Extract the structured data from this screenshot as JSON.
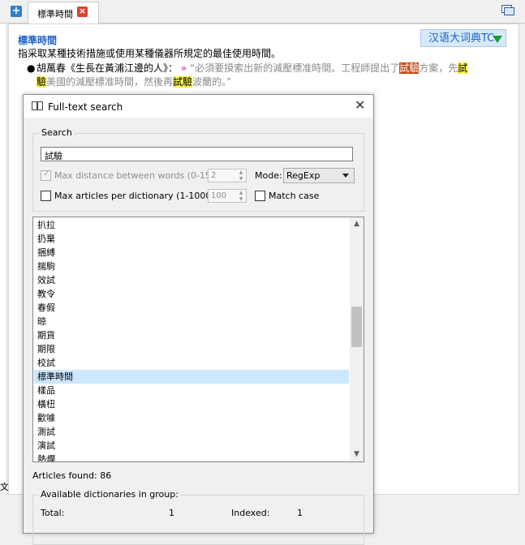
{
  "main": {
    "tab_label": "標準時間",
    "dict_button": "汉语大词典TC",
    "left_snippet": "文当代",
    "headword": "標準時間",
    "definition": "指采取某種技術措施或使用某種儀器所規定的最佳使用時間。",
    "example": {
      "author": "胡萬春《生長在黃浦江邊的人》：",
      "arrow": "»",
      "q1": "“必須要摸索出新的減壓標准時間。工程師提出了",
      "h1": "試驗",
      "q2": "方案，先",
      "h2a": "試",
      "h2b": "驗",
      "q3": "美國的減壓標准時間，然後再",
      "h3": "試驗",
      "q4": "波蘭的。”"
    }
  },
  "dialog": {
    "title": "Full-text search",
    "search_caption": "Search",
    "search_value": "試驗",
    "max_distance_label": "Max distance between words (0-15):",
    "max_distance_checked": true,
    "max_distance_value": "2",
    "mode_label": "Mode:",
    "mode_value": "RegExp",
    "max_articles_label": "Max articles per dictionary (1-10000):",
    "max_articles_checked": false,
    "max_articles_value": "100",
    "match_case_label": "Match case",
    "match_case_checked": false,
    "results": [
      "扒拉",
      "扔棄",
      "捆縛",
      "揣駒",
      "效試",
      "教令",
      "春假",
      "晾",
      "期貨",
      "期限",
      "校試",
      "標準時間",
      "樣品",
      "橫杻",
      "歡噱",
      "測試",
      "演試",
      "熱爛"
    ],
    "selected_result": "標準時間",
    "articles_found": "Articles found: 86",
    "stats_caption": "Available dictionaries in group:",
    "total_label": "Total:",
    "total_value": "1",
    "indexed_label": "Indexed:",
    "indexed_value": "1"
  },
  "colors": {
    "link_blue": "#1f63c4",
    "highlight_yellow": "#fff34c",
    "highlight_orange": "#c84a16",
    "selection": "#cce8ff"
  }
}
